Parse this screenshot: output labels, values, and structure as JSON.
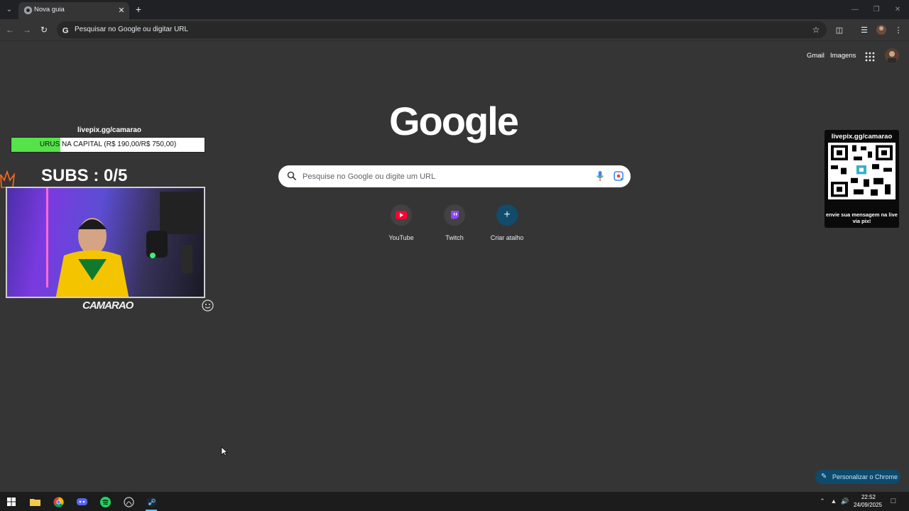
{
  "browser": {
    "tab_title": "Nova guia",
    "omnibox_text": "Pesquisar no Google ou digitar URL"
  },
  "newtab": {
    "top_links": {
      "gmail": "Gmail",
      "images": "Imagens"
    },
    "logo": "Google",
    "search_placeholder": "Pesquise no Google ou digite um URL",
    "shortcuts": [
      {
        "label": "YouTube",
        "icon": "youtube-icon"
      },
      {
        "label": "Twitch",
        "icon": "twitch-icon"
      },
      {
        "label": "Criar atalho",
        "icon": "plus-icon"
      }
    ],
    "customize_label": "Personalizar o Chrome"
  },
  "overlay": {
    "livepix_url": "livepix.gg/camarao",
    "goal_text": "URUS NA CAPITAL (R$ 190,00/R$ 750,00)",
    "goal_progress": 0.253,
    "subs_text": "SUBS : 0/5",
    "streamer_name": "CAMARAO",
    "qr_url": "livepix.gg/camarao",
    "qr_message": "envie sua mensagem na live via pix!"
  },
  "taskbar": {
    "time": "22:52",
    "date": "24/09/2025",
    "apps": [
      "windows-start-icon",
      "file-explorer-icon",
      "chrome-icon",
      "discord-icon",
      "spotify-icon",
      "github-desktop-icon",
      "steam-icon"
    ]
  },
  "colors": {
    "page_bg": "#353535",
    "goal_fill": "#55e24a",
    "youtube": "#ff0033",
    "twitch": "#9146ff",
    "customize_bg": "#0e4a6b"
  }
}
